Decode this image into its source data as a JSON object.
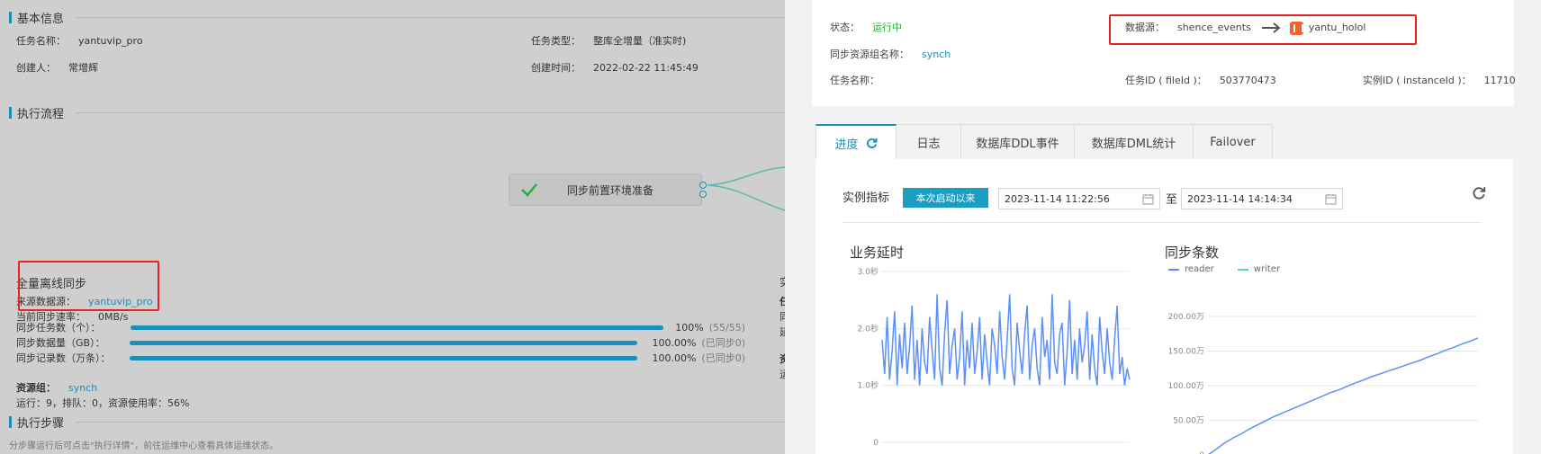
{
  "basic_info": {
    "title": "基本信息",
    "task_name_label": "任务名称：",
    "task_name_value": "yantuvip_pro",
    "task_type_label": "任务类型：",
    "task_type_value": "整库全增量（准实时)",
    "creator_label": "创建人：",
    "creator_value": "常增辉",
    "created_time_label": "创建时间：",
    "created_time_value": "2022-02-22 11:45:49"
  },
  "flow": {
    "title": "执行流程",
    "node_label": "同步前置环境准备"
  },
  "offline_sync": {
    "title": "全量离线同步",
    "source_label": "来源数据源：",
    "source_value": "yantuvip_pro",
    "rate_label": "当前同步速率：",
    "rate_value": "0MB/s",
    "rows": [
      {
        "label": "同步任务数（个）：",
        "pct": "100%",
        "count": "(55/55)",
        "progress": 1.0
      },
      {
        "label": "同步数据量（GB）：",
        "pct": "100.00%",
        "count": "(已同步0)",
        "progress": 1.0
      },
      {
        "label": "同步记录数（万条）：",
        "pct": "100.00%",
        "count": "(已同步0)",
        "progress": 1.0
      }
    ],
    "resource_group_label": "资源组：",
    "resource_group_value": "synch",
    "resource_status": "运行：9，排队：0，资源使用率：56%",
    "cut_chars": [
      "实",
      "任",
      "同",
      "延",
      "资",
      "运"
    ]
  },
  "steps": {
    "title": "执行步骤",
    "hint": "分步骤运行后可点击\"执行详情\"，前往运维中心查看具体运维状态。"
  },
  "drawer": {
    "status_label": "状态：",
    "status_value": "运行中",
    "datasource_label": "数据源：",
    "datasource_from": "shence_events",
    "datasource_to": "yantu_holol",
    "resource_group_label": "同步资源组名称：",
    "resource_group_value": "synch",
    "task_name_label": "任务名称：",
    "task_name_value": "",
    "file_id_label": "任务ID ( fileId )：",
    "file_id_value": "503770473",
    "instance_id_label": "实例ID ( instanceId )：",
    "instance_id_value": "11710"
  },
  "tabs": [
    {
      "label": "进度",
      "active": true
    },
    {
      "label": "日志",
      "active": false
    },
    {
      "label": "数据库DDL事件",
      "active": false
    },
    {
      "label": "数据库DML统计",
      "active": false
    },
    {
      "label": "Failover",
      "active": false
    }
  ],
  "filter": {
    "label": "实例指标",
    "since_button": "本次启动以来",
    "start_date": "2023-11-14 11:22:56",
    "to": "至",
    "end_date": "2023-11-14 14:14:34"
  },
  "colors": {
    "accent": "#1a8fb8",
    "status_running": "#2dab3c",
    "line_blue": "#5b8ff9",
    "line_green": "#5ad8a6",
    "highlight_red": "#e62323"
  },
  "chart_data": [
    {
      "type": "line",
      "title": "业务延时",
      "yticks": [
        "0",
        "1.0秒",
        "2.0秒",
        "3.0秒"
      ],
      "ylim": [
        0,
        3
      ],
      "series": [
        {
          "values": [
            1.8,
            1.2,
            2.2,
            1.1,
            1.6,
            2.3,
            1.0,
            1.9,
            1.3,
            2.1,
            1.2,
            1.7,
            2.4,
            1.1,
            1.8,
            1.0,
            2.0,
            1.4,
            1.2,
            2.2,
            1.6,
            1.1,
            2.6,
            1.3,
            1.0,
            1.9,
            2.5,
            1.2,
            1.7,
            2.0,
            1.1,
            1.5,
            2.3,
            1.0,
            1.8,
            1.3,
            2.1,
            1.2,
            1.6,
            2.2,
            1.1,
            1.9,
            1.4,
            1.0,
            2.0,
            1.7,
            1.2,
            2.3,
            1.5,
            1.1,
            1.8,
            2.6,
            1.3,
            1.0,
            2.1,
            1.6,
            1.2,
            1.9,
            2.4,
            1.1,
            1.7,
            2.0,
            1.3,
            1.0,
            2.2,
            1.5,
            1.8,
            1.1,
            2.6,
            1.4,
            1.2,
            1.9,
            2.1,
            1.0,
            1.6,
            2.5,
            1.2,
            1.8,
            1.1,
            2.0,
            1.4,
            1.7,
            2.3,
            1.1,
            1.9,
            1.3,
            1.0,
            2.2,
            1.6,
            1.2,
            2.0,
            1.4,
            1.1,
            1.8,
            2.4,
            1.2,
            1.5,
            1.0,
            1.3,
            1.1
          ]
        }
      ]
    },
    {
      "type": "line",
      "title": "同步条数",
      "yticks": [
        "0",
        "50.00万",
        "100.00万",
        "150.00万",
        "200.00万"
      ],
      "ylim": [
        0,
        200
      ],
      "legend_position": "top-left",
      "series": [
        {
          "name": "reader",
          "values": [
            0,
            8,
            17,
            24,
            30,
            37,
            43,
            49,
            55,
            60,
            65,
            70,
            75,
            80,
            85,
            90,
            94,
            99,
            104,
            108,
            113,
            117,
            121,
            125,
            129,
            133,
            137,
            142,
            146,
            151,
            155,
            160,
            164,
            169
          ]
        },
        {
          "name": "writer",
          "values": [
            0,
            0,
            0,
            0,
            0,
            0,
            0,
            0,
            0,
            0,
            0,
            0,
            0,
            0,
            0,
            0,
            0,
            0,
            0,
            0,
            0,
            0,
            0,
            0,
            0,
            0,
            0,
            0,
            0,
            0,
            0,
            0,
            0,
            0
          ]
        }
      ]
    }
  ]
}
